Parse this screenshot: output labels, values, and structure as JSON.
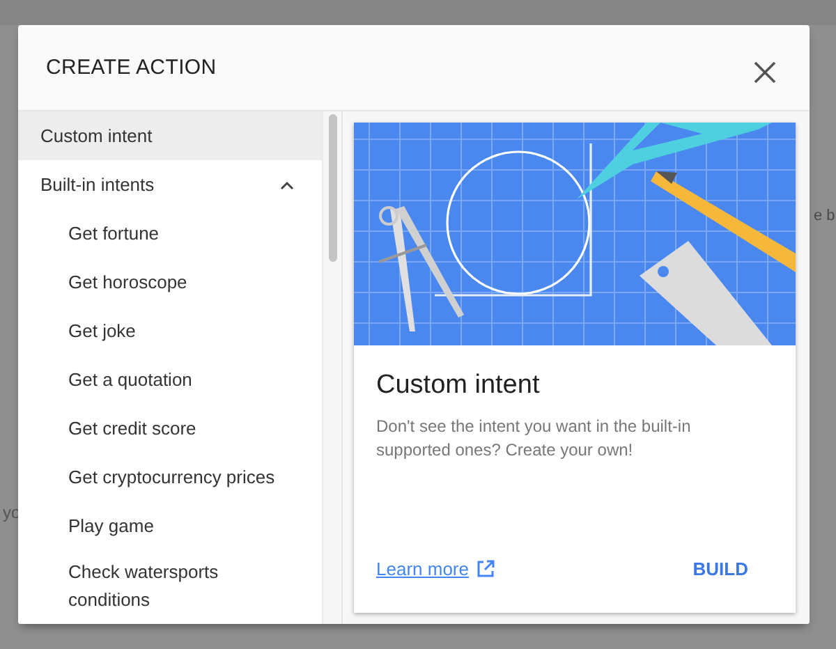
{
  "background": {
    "fragments": [
      "e b",
      "yo"
    ]
  },
  "dialog": {
    "title": "CREATE ACTION"
  },
  "sidebar": {
    "items": [
      {
        "kind": "item",
        "label": "Custom intent",
        "selected": true
      },
      {
        "kind": "group",
        "label": "Built-in intents",
        "expanded": true,
        "selected": false,
        "children": [
          {
            "label": "Get fortune",
            "selected": false
          },
          {
            "label": "Get horoscope",
            "selected": false
          },
          {
            "label": "Get joke",
            "selected": false
          },
          {
            "label": "Get a quotation",
            "selected": false
          },
          {
            "label": "Get credit score",
            "selected": false
          },
          {
            "label": "Get cryptocurrency prices",
            "selected": false
          },
          {
            "label": "Play game",
            "selected": false
          },
          {
            "label": "Check watersports conditions",
            "selected": false
          }
        ]
      }
    ]
  },
  "card": {
    "title": "Custom intent",
    "description": "Don't see the intent you want in the built-in supported ones? Create your own!",
    "link": "Learn more",
    "button": "BUILD"
  }
}
